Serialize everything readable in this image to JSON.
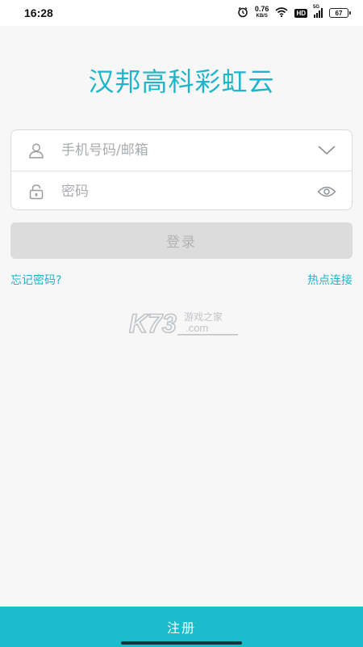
{
  "status_bar": {
    "time": "16:28",
    "net_speed_value": "0.76",
    "net_speed_unit": "KB/S",
    "hd_label": "HD",
    "signal_label": "5G",
    "battery_level": "67"
  },
  "app": {
    "title": "汉邦高科彩虹云"
  },
  "form": {
    "account_placeholder": "手机号码/邮箱",
    "account_value": "",
    "password_placeholder": "密码",
    "password_value": ""
  },
  "actions": {
    "login_label": "登录",
    "forgot_password_label": "忘记密码?",
    "hotspot_label": "热点连接",
    "register_label": "注册"
  },
  "watermark": {
    "brand_text": "K73",
    "tagline": "游戏之家",
    "domain": ".com"
  },
  "colors": {
    "accent": "#1fb5c9",
    "register_bar": "#1bbccc",
    "button_disabled_bg": "#dcdcdd",
    "button_disabled_text": "#b2b3b5",
    "background": "#f7f7f8"
  }
}
